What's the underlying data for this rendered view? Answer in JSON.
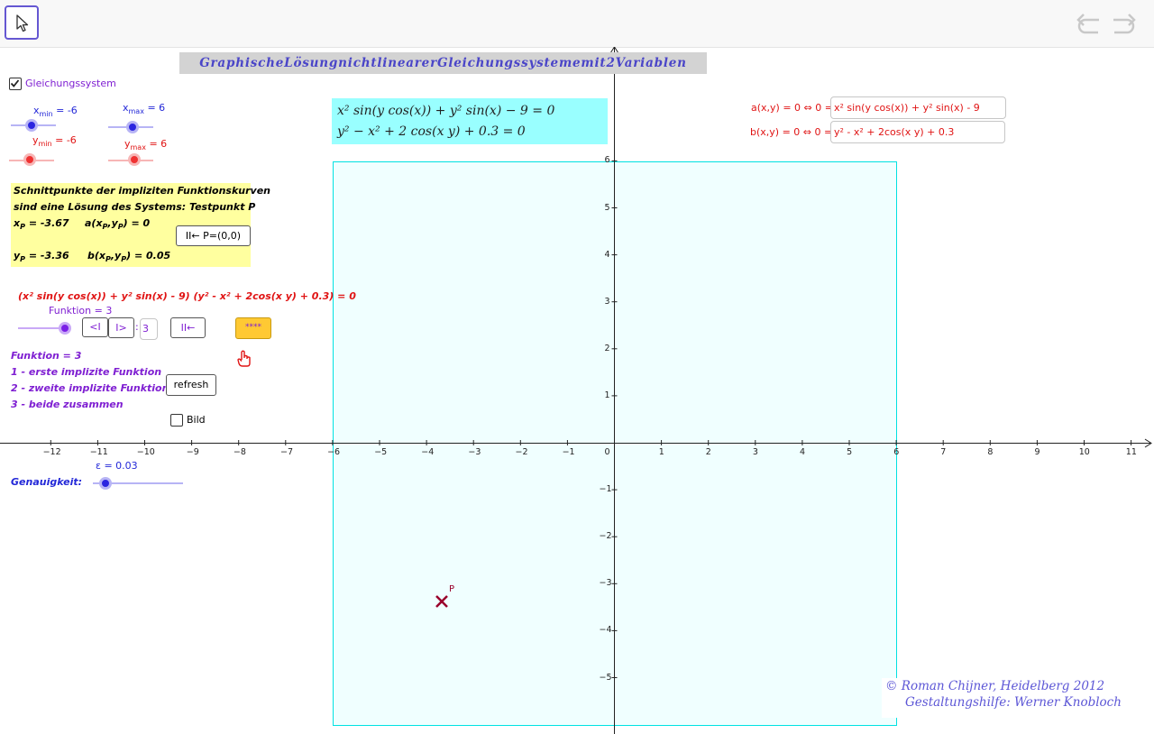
{
  "toolbar": {
    "move_tool": "move-tool",
    "undo": "undo-icon",
    "redo": "redo-icon"
  },
  "title": "GraphischeLösungnichtlinearerGleichungssystememit2Variablen",
  "checkbox_system": {
    "label": "Gleichungssystem",
    "checked": true
  },
  "sliders": {
    "xmin": {
      "name": "x",
      "sub": "min",
      "value_text": " = -6",
      "value": -6
    },
    "xmax": {
      "name": "x",
      "sub": "max",
      "value_text": " = 6",
      "value": 6
    },
    "ymin": {
      "name": "y",
      "sub": "min",
      "value_text": " = -6",
      "value": -6
    },
    "ymax": {
      "name": "y",
      "sub": "max",
      "value_text": " = 6",
      "value": 6
    }
  },
  "info_box": {
    "line1": "Schnittpunkte der impliziten Funktionskurven",
    "line2": "sind eine Lösung des Systems: Testpunkt P",
    "xp_label": "x",
    "xp_sub": "P",
    "xp_value": " = -3.67",
    "a_label": "a(x",
    "a_value": ") = 0",
    "yp_label": "y",
    "yp_sub": "P",
    "yp_value": " = -3.36",
    "b_label": "b(x",
    "b_value": ") = 0.05",
    "p_sub": "P",
    "comma_y": ",y",
    "reset_button": "II← P=(0,0)"
  },
  "product_expr": "(x² sin(y cos(x)) + y² sin(x) - 9) (y² - x² + 2cos(x y) + 0.3) = 0",
  "funktion_slider": {
    "label": "Funktion = 3",
    "value": 3
  },
  "nav_buttons": {
    "prev": "<I",
    "next": "I>",
    "colon": ":",
    "input": "3",
    "reset": "II←",
    "stars": "****"
  },
  "funktion_info": {
    "line0": "Funktion = 3",
    "line1": "1 - erste implizite Funktion",
    "line2": "2 - zweite implizite Funktion",
    "line3": "3 - beide zusammen"
  },
  "refresh_button": "refresh",
  "bild_checkbox": {
    "label": "Bild",
    "checked": false
  },
  "epsilon": {
    "label": "ε = 0.03",
    "value": 0.03
  },
  "genauigkeit_label": "Genauigkeit:",
  "equations": {
    "line1": "x² sin(y cos(x)) + y² sin(x) − 9 = 0",
    "line2": "y² − x² + 2 cos(x y) + 0.3 = 0"
  },
  "inputs": {
    "a_label": "a(x,y) = 0 ⇔ 0 =:",
    "a_value": "x² sin(y cos(x)) + y² sin(x) - 9",
    "b_label": "b(x,y) = 0 ⇔ 0 =:",
    "b_value": "y² - x² + 2cos(x y) + 0.3"
  },
  "point_P": {
    "label": "P",
    "x": -3.67,
    "y": -3.36
  },
  "axis": {
    "x_ticks": [
      "−12",
      "−11",
      "−10",
      "−9",
      "−8",
      "−7",
      "−6",
      "−5",
      "−4",
      "−3",
      "−2",
      "−1",
      "0",
      "1",
      "2",
      "3",
      "4",
      "5",
      "6",
      "7",
      "8",
      "9",
      "10",
      "11"
    ],
    "y_ticks_pos": [
      "6",
      "5",
      "4",
      "3",
      "2",
      "1"
    ],
    "y_ticks_neg": [
      "−1",
      "−2",
      "−3",
      "−4",
      "−5"
    ]
  },
  "copyright": {
    "line1": "© Roman Chijner, Heidelberg 2012",
    "line2": "Gestaltungshilfe: Werner Knobloch"
  },
  "colors": {
    "accent": "#6557d2",
    "region": "#f0ffff",
    "region_border": "#00e2e2",
    "equation_bg": "#99ffff",
    "info_bg": "#ffff9f",
    "point": "#99002b"
  }
}
